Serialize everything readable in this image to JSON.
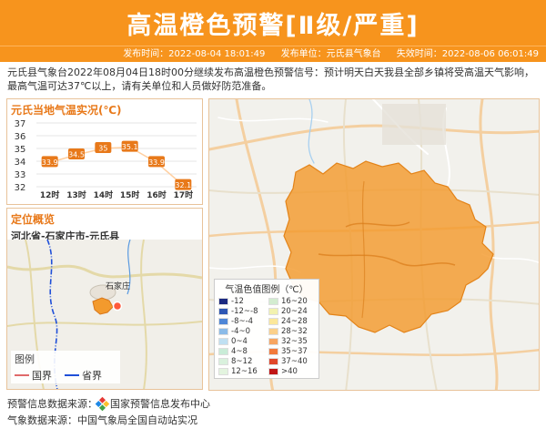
{
  "header": {
    "title": "高温橙色预警[Ⅱ级/严重]",
    "publish_time": "发布时间：2022-08-04 18:01:49",
    "publisher": "发布单位：元氏县气象台",
    "expire_time": "失效时间：2022-08-06 06:01:49"
  },
  "description": "元氏县气象台2022年08月04日18时00分继续发布高温橙色预警信号：预计明天白天我县全部乡镇将受高温天气影响，最高气温可达37℃以上，请有关单位和人员做好防范准备。",
  "temperature_panel": {
    "title": "元氏当地气温实况(℃)"
  },
  "chart_data": {
    "type": "line",
    "title": "元氏当地气温实况(℃)",
    "categories": [
      "12时",
      "13时",
      "14时",
      "15时",
      "16时",
      "17时"
    ],
    "values": [
      33.9,
      34.5,
      35,
      35.1,
      33.9,
      32.1
    ],
    "y_ticks": [
      32,
      33,
      34,
      35,
      36,
      37
    ],
    "ylim": [
      32,
      37
    ],
    "grid": true
  },
  "location_panel": {
    "title": "定位概览",
    "region": "河北省-石家庄市-元氏县",
    "city_label": "石家庄",
    "legend": {
      "title": "图例",
      "national_border": "国界",
      "provincial_border": "省界",
      "national_color": "#e06a6a",
      "provincial_color": "#1f4fd8"
    }
  },
  "map_legend": {
    "title": "气温色值图例（℃）",
    "items": [
      {
        "label": "-12",
        "color": "#1b2a80"
      },
      {
        "label": "16~20",
        "color": "#d3ecd0"
      },
      {
        "label": "-12~-8",
        "color": "#2e57b3"
      },
      {
        "label": "20~24",
        "color": "#f2f2b0"
      },
      {
        "label": "-8~-4",
        "color": "#4f86d6"
      },
      {
        "label": "24~28",
        "color": "#fbe79a"
      },
      {
        "label": "-4~0",
        "color": "#8bbbe8"
      },
      {
        "label": "28~32",
        "color": "#fbd08a"
      },
      {
        "label": "0~4",
        "color": "#bfe0f2"
      },
      {
        "label": "32~35",
        "color": "#f7a561"
      },
      {
        "label": "4~8",
        "color": "#c9ecd7"
      },
      {
        "label": "35~37",
        "color": "#f27a3b"
      },
      {
        "label": "8~12",
        "color": "#d9f1dd"
      },
      {
        "label": "37~40",
        "color": "#e0472a"
      },
      {
        "label": "12~16",
        "color": "#e3f4df"
      },
      {
        "label": ">40",
        "color": "#c01515"
      }
    ]
  },
  "footer": {
    "warning_source": "预警信息数据来源：",
    "warning_source_name": "国家预警信息发布中心",
    "weather_source": "气象数据来源：中国气象局全国自动站实况"
  },
  "colors": {
    "accent": "#f7941d",
    "chart_line": "#ffcfa0",
    "chart_label_bg": "#e8791a",
    "region_fill": "#f39a2d"
  }
}
